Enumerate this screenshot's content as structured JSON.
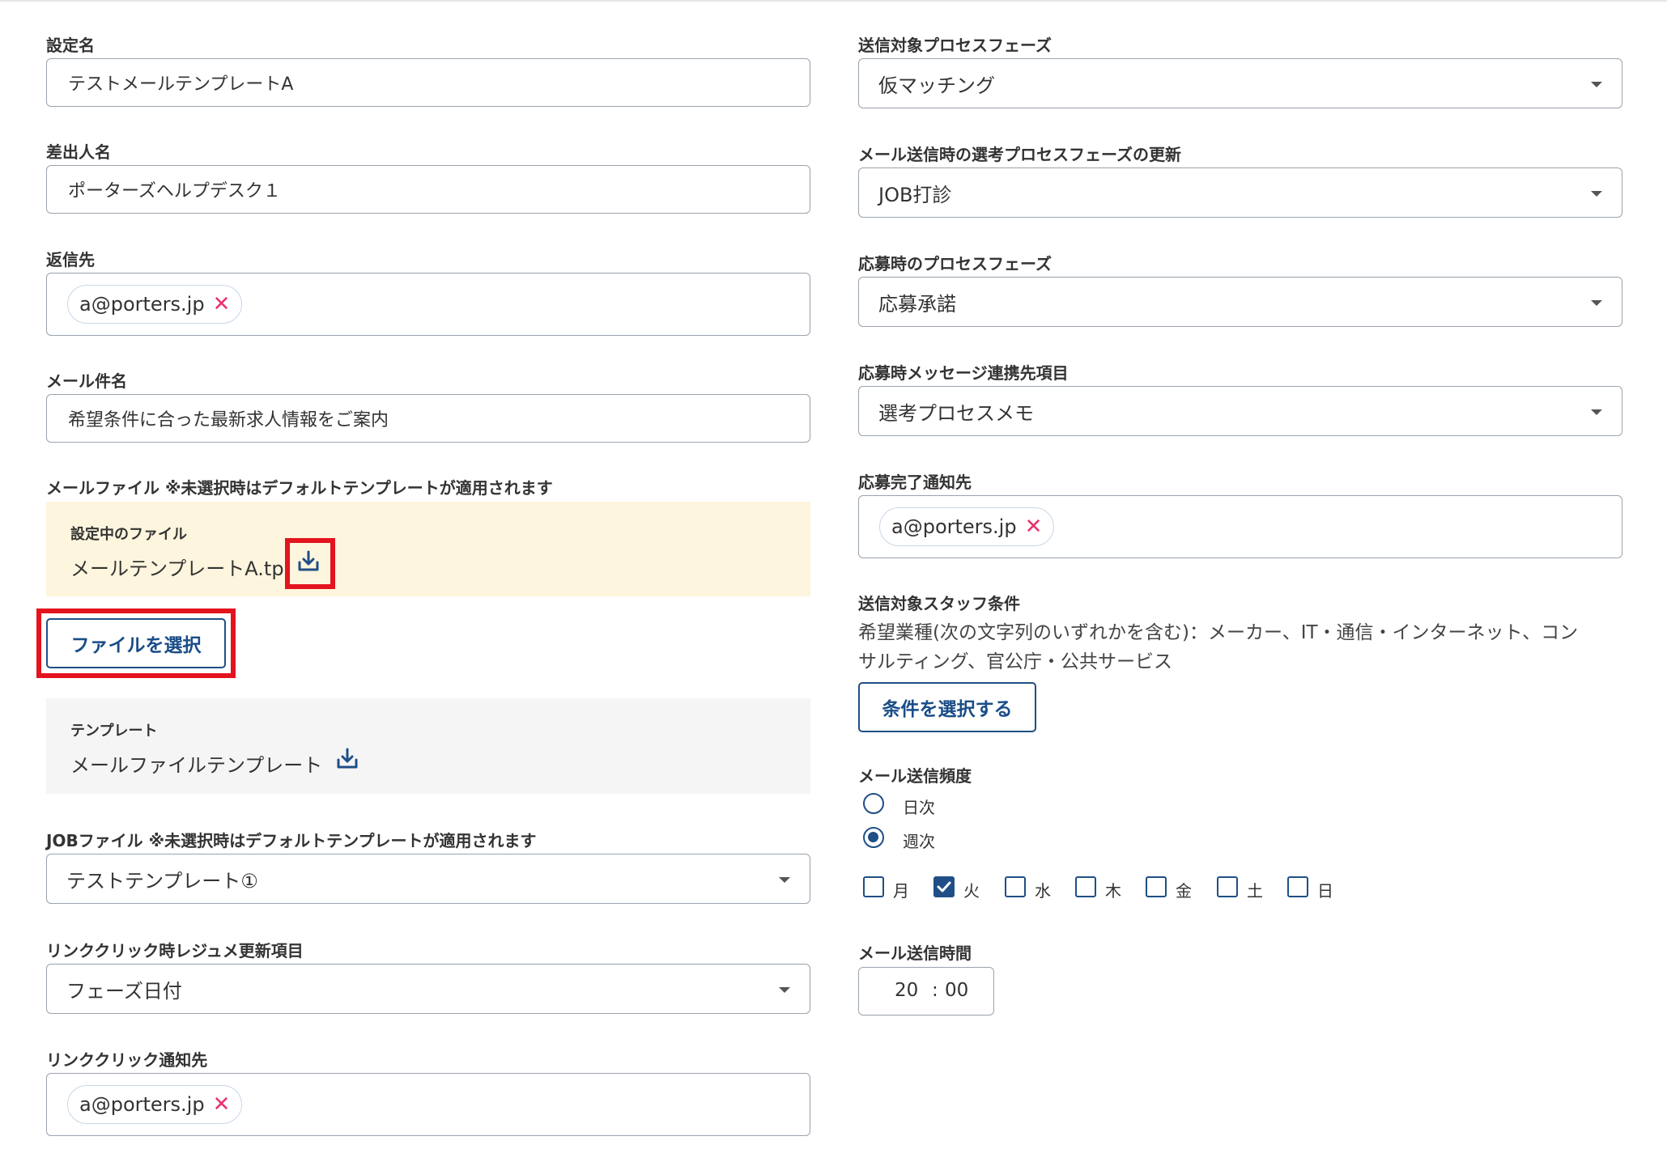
{
  "left": {
    "setting_name": {
      "label": "設定名",
      "value": "テストメールテンプレートA"
    },
    "sender_name": {
      "label": "差出人名",
      "value": "ポーターズヘルプデスク１"
    },
    "reply_to": {
      "label": "返信先",
      "chips": [
        "a@porters.jp"
      ]
    },
    "subject": {
      "label": "メール件名",
      "value": "希望条件に合った最新求人情報をご案内"
    },
    "mail_file": {
      "label": "メールファイル ※未選択時はデフォルトテンプレートが適用されます",
      "current_label": "設定中のファイル",
      "current_file": "メールテンプレートA.tpl",
      "select_button": "ファイルを選択",
      "template_label": "テンプレート",
      "template_name": "メールファイルテンプレート"
    },
    "job_file": {
      "label": "JOBファイル ※未選択時はデフォルトテンプレートが適用されます",
      "selected": "テストテンプレート①"
    },
    "link_click_resume": {
      "label": "リンククリック時レジュメ更新項目",
      "selected": "フェーズ日付"
    },
    "link_click_notify": {
      "label": "リンククリック通知先",
      "chips": [
        "a@porters.jp"
      ]
    }
  },
  "right": {
    "target_phase": {
      "label": "送信対象プロセスフェーズ",
      "selected": "仮マッチング"
    },
    "update_phase": {
      "label": "メール送信時の選考プロセスフェーズの更新",
      "selected": "JOB打診"
    },
    "apply_phase": {
      "label": "応募時のプロセスフェーズ",
      "selected": "応募承諾"
    },
    "apply_message_field": {
      "label": "応募時メッセージ連携先項目",
      "selected": "選考プロセスメモ"
    },
    "apply_notify": {
      "label": "応募完了通知先",
      "chips": [
        "a@porters.jp"
      ]
    },
    "staff_condition": {
      "label": "送信対象スタッフ条件",
      "line1": "希望業種(次の文字列のいずれかを含む)：メーカー、IT・通信・インターネット、コン",
      "line2": "サルティング、官公庁・公共サービス",
      "button": "条件を選択する"
    },
    "frequency": {
      "label": "メール送信頻度",
      "options": [
        {
          "label": "日次",
          "selected": false
        },
        {
          "label": "週次",
          "selected": true
        }
      ],
      "days": [
        {
          "label": "月",
          "checked": false
        },
        {
          "label": "火",
          "checked": true
        },
        {
          "label": "水",
          "checked": false
        },
        {
          "label": "木",
          "checked": false
        },
        {
          "label": "金",
          "checked": false
        },
        {
          "label": "土",
          "checked": false
        },
        {
          "label": "日",
          "checked": false
        }
      ]
    },
    "send_time": {
      "label": "メール送信時間",
      "hour": "20",
      "separator": ":",
      "minute": "00"
    }
  },
  "icons": {
    "download": "download-icon",
    "close": "close-icon",
    "dropdown": "chevron-down-icon",
    "check": "checkmark-icon"
  },
  "colors": {
    "accent": "#1f4f86",
    "chip_remove": "#e8336b",
    "highlight_box": "#e3141e",
    "file_area_bg": "#fdf5dd"
  }
}
